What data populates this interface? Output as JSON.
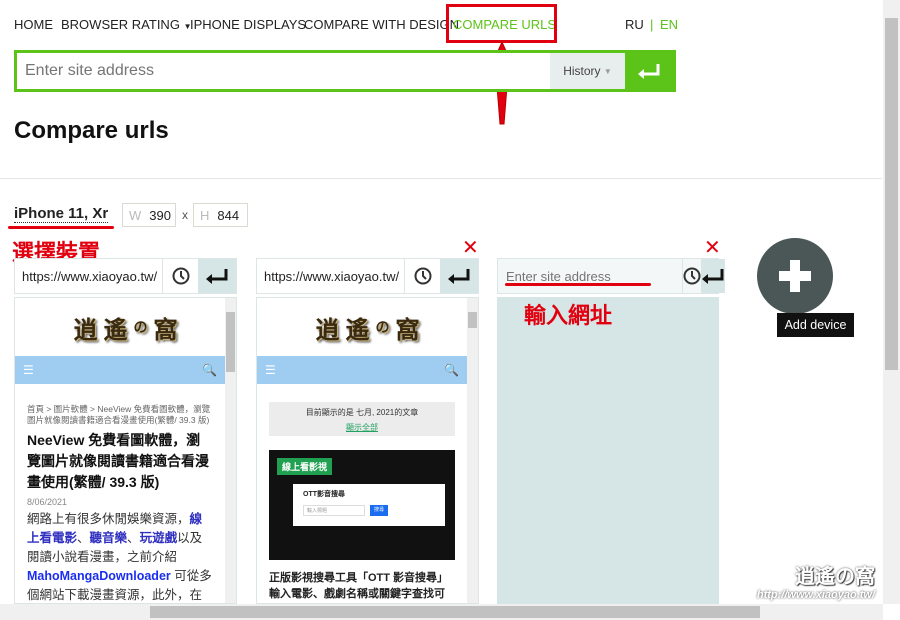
{
  "nav": {
    "items": [
      "HOME",
      "BROWSER RATING",
      "IPHONE DISPLAYS",
      "COMPARE WITH DESIGN",
      "COMPARE URLS"
    ],
    "lang_ru": "RU",
    "lang_sep": "|",
    "lang_en": "EN",
    "active_color": "#5cc318"
  },
  "search": {
    "placeholder": "Enter site address",
    "history": "History"
  },
  "page": {
    "title": "Compare urls"
  },
  "device": {
    "name": "iPhone 11, Xr",
    "w_label": "W",
    "w": "390",
    "x": "x",
    "h_label": "H",
    "h": "844"
  },
  "annotations": {
    "select_device": "選擇裝置",
    "enter_url": "輸入網址"
  },
  "columns": [
    {
      "url": "https://www.xiaoyao.tw/",
      "logo": [
        "逍",
        "遙",
        "の",
        "窩"
      ],
      "breadcrumb": "首頁 > 圖片軟體 > NeeView 免費看圖軟體，瀏覽圖片就像閱讀書籍適合看漫畫使用(繁體/ 39.3 版)",
      "title": "NeeView 免費看圖軟體，瀏覽圖片就像閱讀書籍適合看漫畫使用(繁體/ 39.3 版)",
      "date": "8/06/2021",
      "p1": "網路上有很多休閒娛樂資源，",
      "l1": "線上看電影",
      "s1": "、",
      "l2": "聽音樂",
      "s2": "、",
      "l3": "玩遊戲",
      "p2": "以及閱讀小說看漫畫，之前介紹",
      "l4": "MahoMangaDownloader",
      "p3": " 可從多個網站下載漫畫資源，此外，在"
    },
    {
      "url": "https://www.xiaoyao.tw/",
      "logo": [
        "逍",
        "遙",
        "の",
        "窩"
      ],
      "notice": "目前顯示的是 七月, 2021的文章",
      "show_all": "顯示全部",
      "badge": "線上看影視",
      "dialog_title": "OTT影音搜尋",
      "dialog_input": "輸入標題",
      "dialog_btn": "搜尋",
      "title": "正版影視搜尋工具「OTT 影音搜尋」輸入電影、戲劇名稱或關鍵字查找可觀看平台"
    },
    {
      "placeholder": "Enter site address"
    }
  ],
  "add_device": {
    "tooltip": "Add device"
  },
  "watermark": {
    "logo": "逍遙の窩",
    "url": "http://www.xiaoyao.tw/"
  }
}
